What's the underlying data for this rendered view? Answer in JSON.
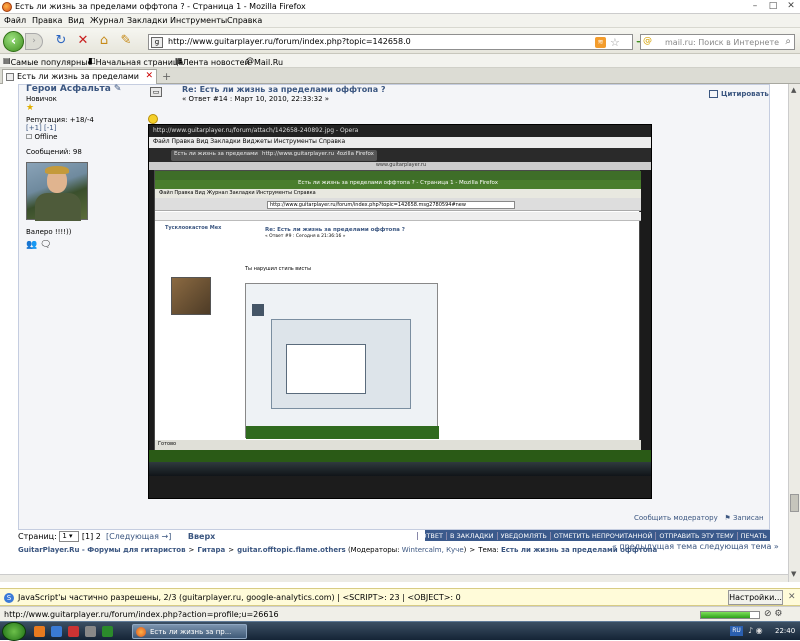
{
  "window": {
    "title": "Есть ли жизнь за пределами оффтопа ? - Страница 1 - Mozilla Firefox"
  },
  "menu": [
    "Файл",
    "Правка",
    "Вид",
    "Журнал",
    "Закладки",
    "Инструменты",
    "Справка"
  ],
  "nav": {
    "url": "http://www.guitarplayer.ru/forum/index.php?topic=142658.0",
    "search_placeholder": "mail.ru: Поиск в Интернете",
    "search_engine_label": "@"
  },
  "bookmarks": [
    "Самые популярные",
    "Начальная страница",
    "Лента новостей",
    "Mail.Ru"
  ],
  "tab": {
    "label": "Есть ли жизнь за пределами оффто...",
    "new_tab": "+"
  },
  "user": {
    "name": "Герои Асфальта",
    "status": "Новичок",
    "reputation": "Репутация: +18/-4",
    "rep_links": "[+1] [-1]",
    "online": "Offline",
    "messages": "Сообщений: 98",
    "signature": "Валеро !!!!))"
  },
  "post": {
    "title": "Re: Есть ли жизнь за пределами оффтопа ?",
    "meta": "« Ответ #14 : Март 10, 2010, 22:33:32 »",
    "quote_label": "Цитировать",
    "notify_moderator": "Сообщить модератору",
    "log": "Записан"
  },
  "screenshot": {
    "opera_title": "http://www.guitarplayer.ru/forum/attach/142658-240892.jpg - Opera",
    "opera_menu": "Файл   Правка   Вид   Закладки   Виджеты   Инструменты   Справка",
    "opera_tab": "http://www.guitarplayer.ru",
    "opera_strip": "www.guitarplayer.ru",
    "ff_title": "Есть ли жизнь за пределами оффтопа ? - Страница 1 - Mozilla Firefox",
    "ff_menu": "Файл   Правка   Вид   Журнал   Закладки   Инструменты   Справка",
    "ff_url": "http://www.guitarplayer.ru/forum/index.php?topic=142658.msg2780594#new",
    "user": "Тусклоокастое Мех",
    "post_title": "Re: Есть ли жизнь за пределами оффтопа ?",
    "post_meta": "« Ответ #9 : Сегодня в 21:36:16 »",
    "text": "Ты нарушил стиль висты",
    "status": "Готово"
  },
  "pager": {
    "label": "Страниц:",
    "select_value": "1",
    "pages": "[1] 2",
    "next": "[Следующая →]",
    "up": "Вверх"
  },
  "actions": [
    "ОТВЕТ",
    "В ЗАКЛАДКИ",
    "УВЕДОМЛЯТЬ",
    "ОТМЕТИТЬ НЕПРОЧИТАННОЙ",
    "ОТПРАВИТЬ ЭТУ ТЕМУ",
    "ПЕЧАТЬ"
  ],
  "breadcrumb": {
    "site": "GuitarPlayer.Ru - Форумы для гитаристов",
    "cat": "Гитара",
    "board": "guitar.offtopic.flame.others",
    "mods_label": "(Модераторы:",
    "mods": "Wintercalm, Куче",
    "mods_end": ")",
    "topic_label": "Тема:",
    "topic": "Есть ли жизнь за пределами оффтопа",
    "nextprev": "« предыдущая тема следующая тема »"
  },
  "notify": {
    "text": "JavaScript'ы частично разрешены, 2/3 (guitarplayer.ru, google-analytics.com) | <SCRIPT>: 23 | <OBJECT>: 0",
    "button": "Настройки..."
  },
  "status": {
    "url": "http://www.guitarplayer.ru/forum/index.php?action=profile;u=26616",
    "progress": 0.85
  },
  "taskbar": {
    "task": "Есть ли жизнь за пр...",
    "lang": "RU",
    "clock": "22:40"
  }
}
